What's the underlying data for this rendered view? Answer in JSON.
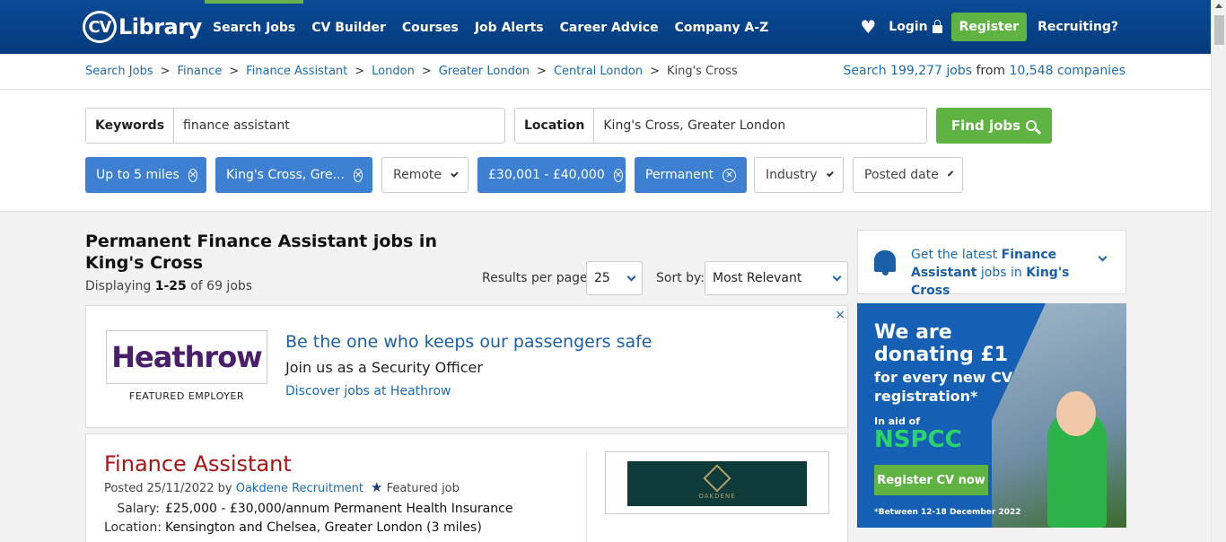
{
  "header": {
    "logo_cv": "CV",
    "logo_library": "Library",
    "nav": [
      "Search Jobs",
      "CV Builder",
      "Courses",
      "Job Alerts",
      "Career Advice",
      "Company A-Z"
    ],
    "login": "Login",
    "register": "Register",
    "recruiting": "Recruiting?"
  },
  "breadcrumb": {
    "items": [
      "Search Jobs",
      "Finance",
      "Finance Assistant",
      "London",
      "Greater London",
      "Central London"
    ],
    "current": "King's Cross",
    "separator": ">"
  },
  "search_count": {
    "prefix": "Search 199,277 jobs",
    "middle": " from ",
    "suffix": "10,548 companies"
  },
  "search": {
    "keywords_label": "Keywords",
    "keywords_value": "finance assistant",
    "location_label": "Location",
    "location_value": "King's Cross, Greater London",
    "find_button": "Find jobs"
  },
  "filters": {
    "distance": "Up to 5 miles",
    "location": "King's Cross, Gre...",
    "remote": "Remote",
    "salary": "£30,001 - £40,000",
    "type": "Permanent",
    "industry": "Industry",
    "posted_date": "Posted date",
    "remove_glyph": "⊗"
  },
  "results": {
    "title": "Permanent Finance Assistant jobs in King's Cross",
    "displaying_prefix": "Displaying ",
    "displaying_range": "1-25",
    "displaying_suffix": " of 69 jobs",
    "per_page_label": "Results per page:",
    "per_page_value": "25",
    "sort_label": "Sort by:",
    "sort_value": "Most Relevant"
  },
  "featured_employer": {
    "logo_text": "Heathrow",
    "tag": "FEATURED EMPLOYER",
    "headline": "Be the one who keeps our passengers safe",
    "subline": "Join us as a Security Officer",
    "link": "Discover jobs at Heathrow",
    "close": "×"
  },
  "job": {
    "title": "Finance Assistant",
    "posted_prefix": "Posted 25/11/2022 by ",
    "company": "Oakdene Recruitment",
    "featured": "Featured job",
    "salary_label": "Salary:",
    "salary": "£25,000 - £30,000/annum Permanent Health Insurance",
    "location_label": "Location:",
    "location": "Kensington and Chelsea, Greater London (3 miles)",
    "logo_text": "OAKDENE"
  },
  "alert": {
    "prefix": "Get the latest ",
    "role": "Finance Assistant",
    "middle": " jobs in ",
    "place": "King's Cross"
  },
  "ad": {
    "line1": "We are",
    "line1b": "donating £1",
    "line2": "for every new CV registration*",
    "line3": "In aid of",
    "line4": "NSPCC",
    "button": "Register CV now",
    "footnote": "*Between 12-18 December 2022"
  },
  "colors": {
    "brand_blue": "#063b7d",
    "accent_green": "#5fb342",
    "chip_blue": "#3d7fd1",
    "job_title_red": "#a81414"
  }
}
